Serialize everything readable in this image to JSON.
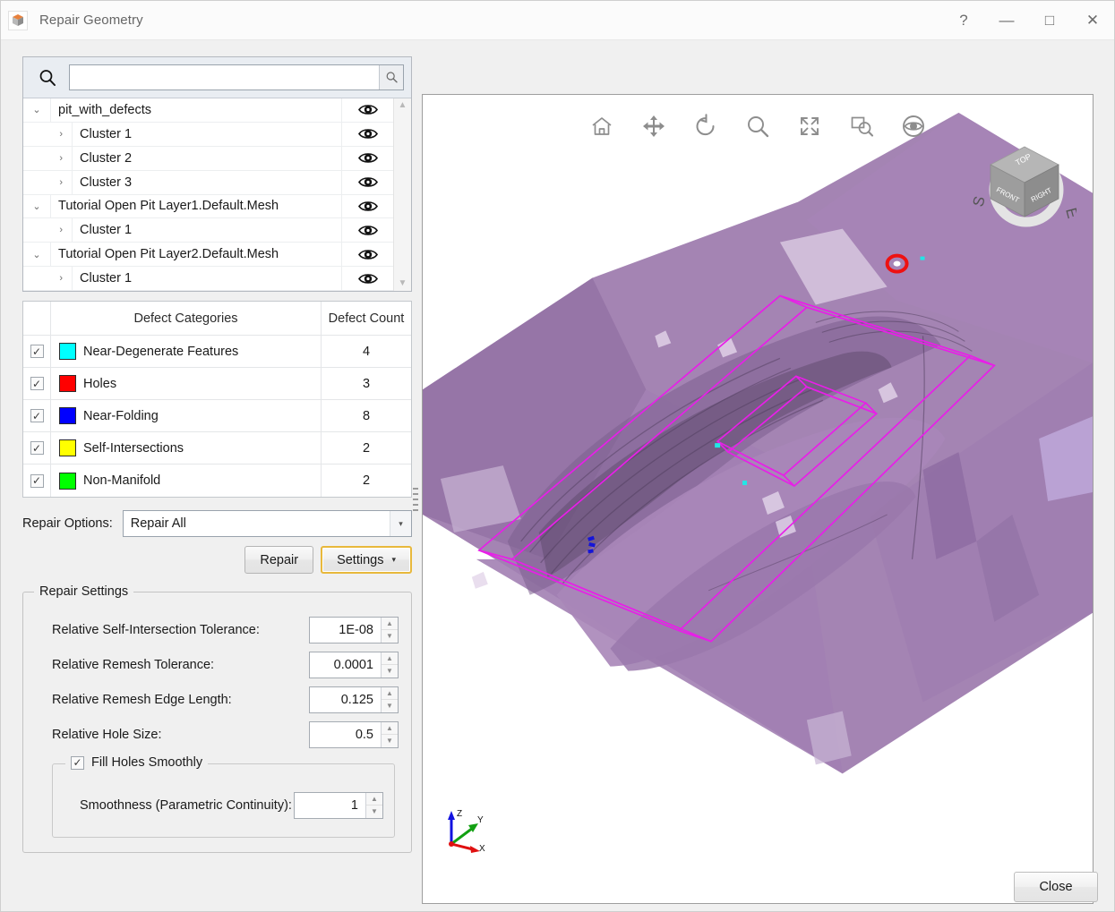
{
  "window": {
    "title": "Repair Geometry",
    "icon": "cube-icon",
    "controls": {
      "help": "?",
      "minimize": "—",
      "maximize": "□",
      "close": "✕"
    }
  },
  "search": {
    "value": "",
    "placeholder": "",
    "icon": "search-icon",
    "button_icon": "search-small-icon"
  },
  "tree": {
    "items": [
      {
        "label": "pit_with_defects",
        "level": 0,
        "expanded": true,
        "twisty": "chevron-down",
        "visibility": "eye-icon"
      },
      {
        "label": "Cluster 1",
        "level": 1,
        "expanded": false,
        "twisty": "chevron-right",
        "visibility": "eye-icon"
      },
      {
        "label": "Cluster 2",
        "level": 1,
        "expanded": false,
        "twisty": "chevron-right",
        "visibility": "eye-icon"
      },
      {
        "label": "Cluster 3",
        "level": 1,
        "expanded": false,
        "twisty": "chevron-right",
        "visibility": "eye-icon"
      },
      {
        "label": "Tutorial Open Pit Layer1.Default.Mesh",
        "level": 0,
        "expanded": true,
        "twisty": "chevron-down",
        "visibility": "eye-icon"
      },
      {
        "label": "Cluster 1",
        "level": 1,
        "expanded": false,
        "twisty": "chevron-right",
        "visibility": "eye-icon"
      },
      {
        "label": "Tutorial Open Pit Layer2.Default.Mesh",
        "level": 0,
        "expanded": true,
        "twisty": "chevron-down",
        "visibility": "eye-icon"
      },
      {
        "label": "Cluster 1",
        "level": 1,
        "expanded": false,
        "twisty": "chevron-right",
        "visibility": "eye-icon"
      }
    ],
    "scroll_up": "▲",
    "scroll_down": "▼"
  },
  "defects": {
    "headers": {
      "checkbox": "",
      "name": "Defect Categories",
      "count": "Defect Count"
    },
    "rows": [
      {
        "checked": true,
        "color": "#00FFFF",
        "name": "Near-Degenerate Features",
        "count": "4"
      },
      {
        "checked": true,
        "color": "#FF0000",
        "name": "Holes",
        "count": "3"
      },
      {
        "checked": true,
        "color": "#0000FF",
        "name": "Near-Folding",
        "count": "8"
      },
      {
        "checked": true,
        "color": "#FFFF00",
        "name": "Self-Intersections",
        "count": "2"
      },
      {
        "checked": true,
        "color": "#00FF00",
        "name": "Non-Manifold",
        "count": "2"
      }
    ],
    "check_glyph": "✓"
  },
  "repair_options": {
    "label": "Repair Options:",
    "value": "Repair All",
    "options": [
      "Repair All"
    ],
    "caret": "▾"
  },
  "buttons": {
    "repair": "Repair",
    "settings": "Settings",
    "settings_caret": "▾",
    "close": "Close"
  },
  "repair_settings": {
    "legend": "Repair Settings",
    "fields": [
      {
        "label": "Relative Self-Intersection Tolerance:",
        "value": "1E-08"
      },
      {
        "label": "Relative Remesh Tolerance:",
        "value": "0.0001"
      },
      {
        "label": "Relative Remesh Edge Length:",
        "value": "0.125"
      },
      {
        "label": "Relative Hole Size:",
        "value": "0.5"
      }
    ],
    "fill_holes": {
      "legend": "Fill Holes Smoothly",
      "checked": true,
      "smoothness_label": "Smoothness (Parametric Continuity):",
      "smoothness_value": "1"
    },
    "spin_up": "▲",
    "spin_down": "▼"
  },
  "viewport": {
    "toolbar": [
      {
        "name": "home-icon",
        "title": "Home"
      },
      {
        "name": "pan-icon",
        "title": "Pan"
      },
      {
        "name": "rotate-icon",
        "title": "Rotate"
      },
      {
        "name": "zoom-icon",
        "title": "Zoom"
      },
      {
        "name": "fit-icon",
        "title": "Fit"
      },
      {
        "name": "zoom-box-icon",
        "title": "Zoom Box"
      },
      {
        "name": "view-eye-icon",
        "title": "View"
      }
    ],
    "viewcube": {
      "top": "TOP",
      "front": "FRONT",
      "right": "RIGHT",
      "compass_s": "S",
      "compass_e": "E"
    },
    "axes": {
      "x": "X",
      "y": "Y",
      "z": "Z",
      "x_color": "#e01010",
      "y_color": "#12a012",
      "z_color": "#1212e0"
    },
    "colors": {
      "mesh": "#9c79ad",
      "mesh_light": "#b79ac4",
      "mesh_dark": "#7d5f8f",
      "box": "#e81ee8",
      "background": "#ffffff"
    }
  }
}
